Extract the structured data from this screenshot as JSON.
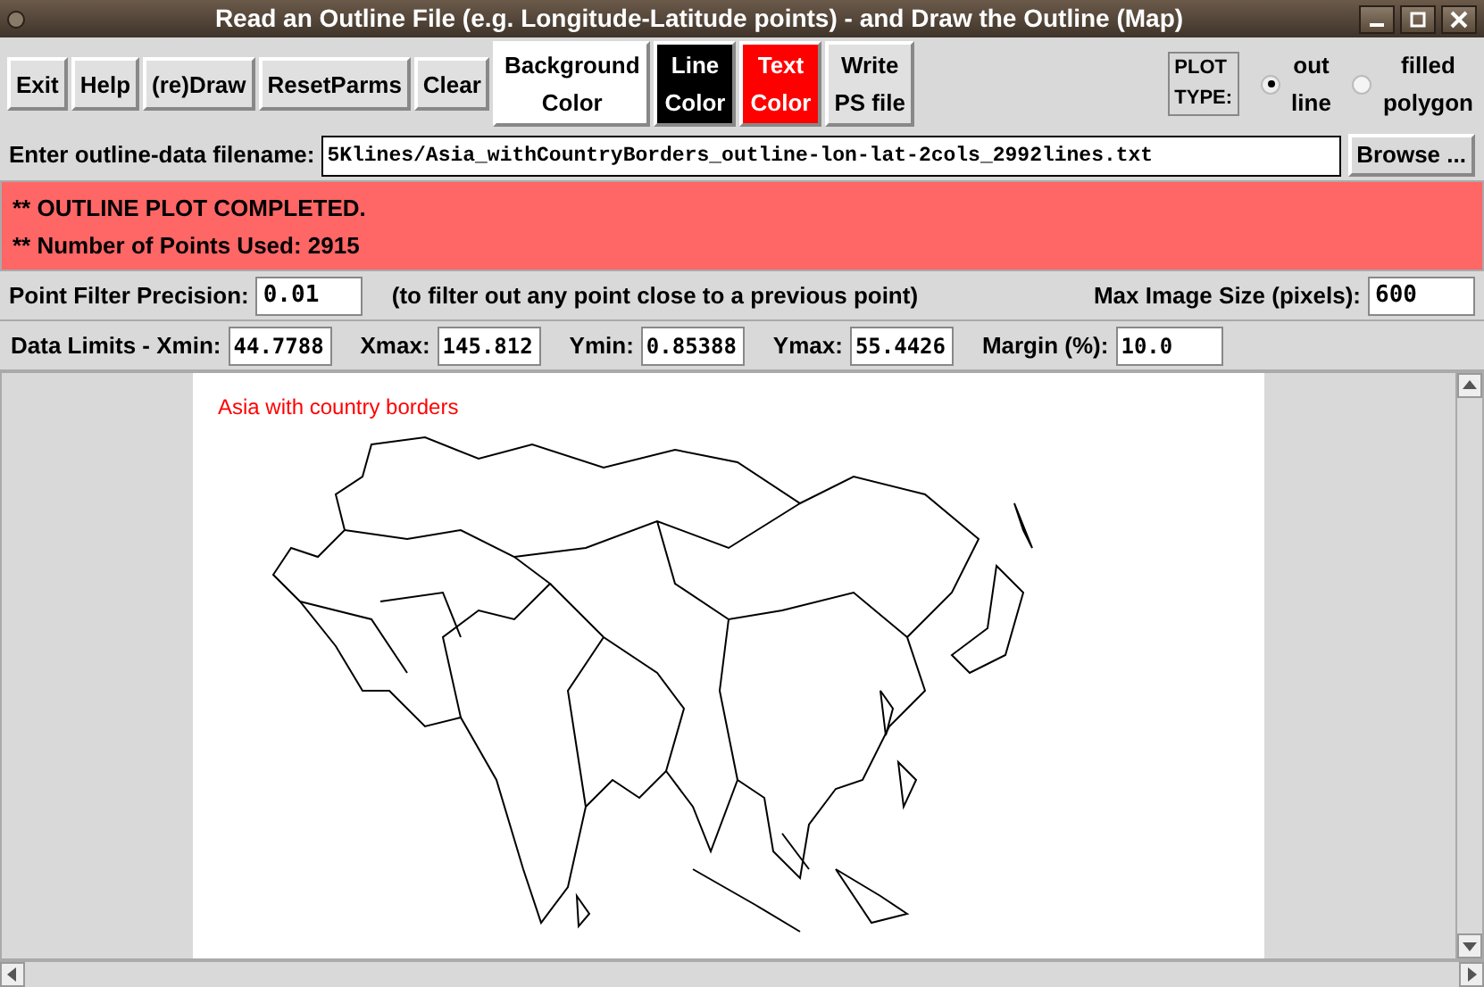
{
  "window": {
    "title": "Read an Outline File (e.g. Longitude-Latitude points) - and Draw the Outline (Map)"
  },
  "toolbar": {
    "buttons": [
      {
        "label": "Exit",
        "kind": "plain"
      },
      {
        "label": "Help",
        "kind": "plain"
      },
      {
        "label": "(re)Draw",
        "kind": "plain"
      },
      {
        "label": "ResetParms",
        "kind": "plain"
      },
      {
        "label": "Clear",
        "kind": "plain"
      },
      {
        "label": "Background\nColor",
        "kind": "color",
        "color": "#ffffff"
      },
      {
        "label": "Line\nColor",
        "kind": "color",
        "color": "#000000"
      },
      {
        "label": "Text\nColor",
        "kind": "color",
        "color": "#ff0000"
      },
      {
        "label": "Write\nPS file",
        "kind": "plain"
      }
    ],
    "plot_type": {
      "label": "PLOT\nTYPE:",
      "options": [
        {
          "label": "out\nline",
          "selected": true
        },
        {
          "label": "filled\npolygon",
          "selected": false
        }
      ]
    }
  },
  "file_row": {
    "label": "Enter outline-data filename:",
    "value": "5Klines/Asia_withCountryBorders_outline-lon-lat-2cols_2992lines.txt",
    "browse": "Browse ..."
  },
  "status": [
    "** OUTLINE PLOT COMPLETED.",
    "** Number of Points Used: 2915"
  ],
  "filter_row": {
    "label": "Point Filter Precision:",
    "value": "0.01",
    "note": "(to filter out any point close to a previous point)",
    "size_label": "Max Image Size (pixels):",
    "size_value": "600"
  },
  "limits_row": [
    {
      "label": "Data Limits - Xmin:",
      "value": "44.7788"
    },
    {
      "label": "Xmax:",
      "value": "145.812"
    },
    {
      "label": "Ymin:",
      "value": "0.85388"
    },
    {
      "label": "Ymax:",
      "value": "55.4426"
    },
    {
      "label": "Margin (%):",
      "value": "10.0"
    }
  ],
  "canvas": {
    "map_title": "Asia with country borders"
  }
}
